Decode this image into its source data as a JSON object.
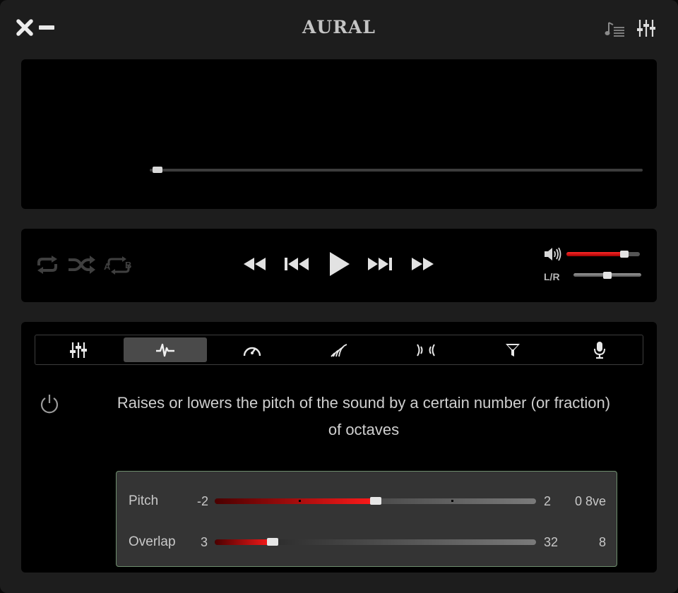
{
  "window": {
    "title": "AURAL"
  },
  "titlebar": {
    "close_icon": "close-icon",
    "minimize_icon": "minimize-icon",
    "playlist_icon": "playlist-icon",
    "effects_icon": "equalizer-icon"
  },
  "player": {
    "seek_position": 0.0
  },
  "controls": {
    "left_icons": [
      "repeat-icon",
      "shuffle-icon",
      "ab-loop-icon"
    ],
    "transport_icons": [
      "seek-backward-icon",
      "previous-track-icon",
      "play-icon",
      "next-track-icon",
      "seek-forward-icon"
    ],
    "volume": {
      "icon": "volume-icon",
      "level": 0.85
    },
    "pan": {
      "label": "L/R",
      "level": 0.5
    }
  },
  "effects": {
    "tabs": [
      {
        "icon": "equalizer-icon",
        "active": false
      },
      {
        "icon": "pitch-icon",
        "active": true
      },
      {
        "icon": "speedometer-icon",
        "active": false
      },
      {
        "icon": "reverb-icon",
        "active": false
      },
      {
        "icon": "delay-icon",
        "active": false
      },
      {
        "icon": "filter-icon",
        "active": false
      },
      {
        "icon": "microphone-icon",
        "active": false
      }
    ],
    "power_icon": "power-icon",
    "description": "Raises or lowers the pitch of the sound by a certain number (or fraction) of octaves",
    "params": [
      {
        "label": "Pitch",
        "min": "-2",
        "max": "2",
        "value": "0 8ve",
        "level": 0.5
      },
      {
        "label": "Overlap",
        "min": "3",
        "max": "32",
        "value": "8",
        "level": 0.18
      }
    ]
  },
  "colors": {
    "accent": "#ff1a1a",
    "panel": "#000000",
    "window": "#1d1d1d"
  }
}
